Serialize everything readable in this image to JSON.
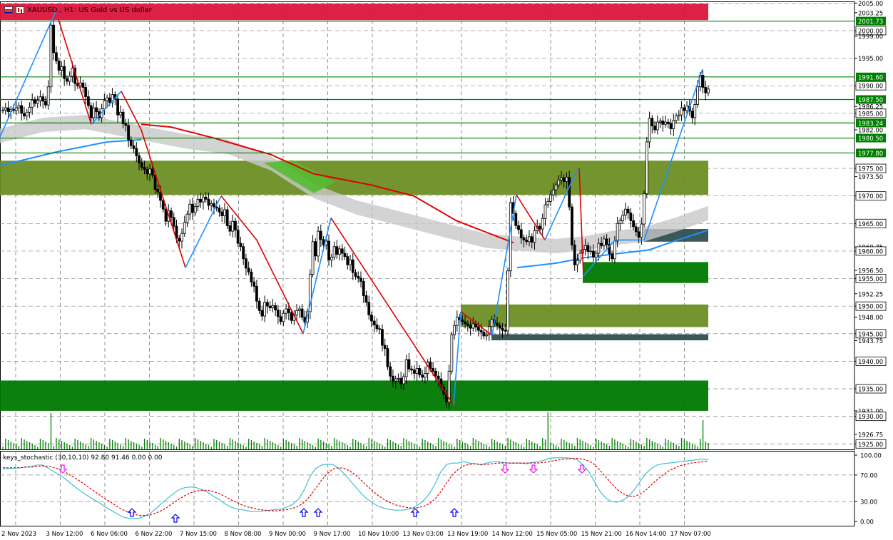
{
  "header": {
    "symbol_text": "XAUUSD., H1:  US Gold vs US dollar"
  },
  "stochastic": {
    "label": "keys_stochastic (30,10,10) 92.80 91.46 0.00 0.00"
  },
  "colors": {
    "bull": "#000000",
    "bear": "#000000",
    "red_zone": "#dc143c",
    "olive_zone": "#6b8e23",
    "green_zone": "#007800",
    "slate_zone": "#2f4f4f",
    "green_line": "#008000",
    "ma_red": "#e00000",
    "ma_blue": "#1e90ff",
    "cloud": "#c8c8c8",
    "zigzag_up": "#1e90ff",
    "zigzag_down": "#e00000",
    "stoch_main": "#40c0d0",
    "stoch_signal": "#e00000",
    "arrow_up": "#0000ff",
    "arrow_down": "#ff00ff"
  },
  "chart_data": [
    {
      "type": "candlestick",
      "title": "XAUUSD., H1:  US Gold vs US dollar",
      "ylim": [
        1924.0,
        2005.3
      ],
      "y_ticks": [
        "2005.00",
        "2003.25",
        "2000.00",
        "1999.00",
        "1995.00",
        "1990.00",
        "1986.25",
        "1985.00",
        "1982.00",
        "1975.00",
        "1973.50",
        "1970.00",
        "1965.00",
        "1960.75",
        "1960.00",
        "1956.50",
        "1955.00",
        "1952.25",
        "1950.00",
        "1948.00",
        "1945.00",
        "1943.75",
        "1940.00",
        "1935.00",
        "1931.00",
        "1930.00",
        "1926.75",
        "1925.00"
      ],
      "x_labels": [
        "2 Nov 2023",
        "3 Nov 12:00",
        "6 Nov 06:00",
        "6 Nov 22:00",
        "7 Nov 15:00",
        "8 Nov 08:00",
        "9 Nov 00:00",
        "9 Nov 17:00",
        "10 Nov 10:00",
        "13 Nov 03:00",
        "13 Nov 19:00",
        "14 Nov 12:00",
        "15 Nov 05:00",
        "15 Nov 21:00",
        "16 Nov 14:00",
        "17 Nov 07:00"
      ],
      "highlighted_levels": [
        {
          "label": "2001.73",
          "kind": "line"
        },
        {
          "label": "2000.00",
          "kind": "box"
        },
        {
          "label": "1991.60",
          "kind": "line"
        },
        {
          "label": "1990.00",
          "kind": "box"
        },
        {
          "label": "1987.50",
          "kind": "line"
        },
        {
          "label": "1985.00",
          "kind": "box"
        },
        {
          "label": "1983.24",
          "kind": "line"
        },
        {
          "label": "1980.50",
          "kind": "line"
        },
        {
          "label": "1977.80",
          "kind": "line"
        },
        {
          "label": "1975.00",
          "kind": "box"
        },
        {
          "label": "1970.00",
          "kind": "box"
        },
        {
          "label": "1965.00",
          "kind": "box"
        },
        {
          "label": "1960.00",
          "kind": "box"
        },
        {
          "label": "1955.00",
          "kind": "box"
        },
        {
          "label": "1950.00",
          "kind": "box"
        },
        {
          "label": "1945.00",
          "kind": "box"
        },
        {
          "label": "1940.00",
          "kind": "box"
        },
        {
          "label": "1935.00",
          "kind": "box"
        },
        {
          "label": "1930.00",
          "kind": "box"
        },
        {
          "label": "1925.00",
          "kind": "box"
        }
      ],
      "horizontal_lines": [
        2001.73,
        1991.6,
        1987.5,
        1983.24,
        1980.5,
        1977.8
      ],
      "zones": [
        {
          "top": 2004.9,
          "bottom": 2001.9,
          "color": "red_zone",
          "x_end": "15 Nov 21:00+"
        },
        {
          "top": 1976.4,
          "bottom": 1970.2,
          "color": "olive_zone",
          "x_end": "17 Nov 07:00-"
        },
        {
          "top": 1936.5,
          "bottom": 1931.0,
          "color": "green_zone",
          "x_end": "17 Nov 07:00-"
        },
        {
          "top": 1950.3,
          "bottom": 1946.2,
          "color": "olive_zone",
          "x_start": "13 Nov 03:00+"
        },
        {
          "top": 1944.9,
          "bottom": 1943.8,
          "color": "slate_zone",
          "x_start": "13 Nov 19:00-"
        },
        {
          "top": 1958.0,
          "bottom": 1954.2,
          "color": "green_zone",
          "x_start": "15 Nov 05:00"
        },
        {
          "top": 1964.0,
          "bottom": 1961.7,
          "color": "slate_zone",
          "x_start": "16 Nov 14:00-"
        }
      ],
      "candles_close": [
        1985.6,
        1986.0,
        1985.3,
        1985.7,
        1985.5,
        1986.0,
        1986.4,
        1985.0,
        1984.5,
        1985.2,
        1986.1,
        1987.4,
        1986.8,
        1987.3,
        1988.0,
        1987.2,
        1986.5,
        1989.8,
        2001.0,
        1996.0,
        1994.5,
        1992.8,
        1993.5,
        1991.3,
        1990.8,
        1991.7,
        1993.2,
        1990.4,
        1990.0,
        1990.5,
        1989.7,
        1988.0,
        1986.4,
        1984.2,
        1986.0,
        1985.3,
        1984.2,
        1985.8,
        1987.3,
        1987.8,
        1986.9,
        1988.4,
        1987.6,
        1984.7,
        1985.2,
        1983.1,
        1982.8,
        1980.2,
        1979.1,
        1978.6,
        1977.3,
        1976.0,
        1975.2,
        1974.8,
        1974.0,
        1974.9,
        1973.8,
        1971.2,
        1970.7,
        1969.2,
        1967.6,
        1965.4,
        1967.3,
        1966.1,
        1964.5,
        1962.3,
        1961.8,
        1963.2,
        1965.2,
        1966.7,
        1968.5,
        1967.0,
        1968.1,
        1969.4,
        1968.9,
        1969.8,
        1969.4,
        1968.3,
        1968.6,
        1968.0,
        1967.8,
        1967.1,
        1966.4,
        1967.5,
        1964.6,
        1963.6,
        1965.4,
        1963.8,
        1961.4,
        1960.8,
        1958.6,
        1956.9,
        1956.2,
        1954.4,
        1953.6,
        1950.9,
        1949.2,
        1948.2,
        1950.7,
        1950.0,
        1949.7,
        1950.1,
        1949.3,
        1948.1,
        1947.2,
        1948.7,
        1949.5,
        1948.8,
        1947.4,
        1948.4,
        1949.2,
        1949.5,
        1948.0,
        1947.1,
        1949.0,
        1955.8,
        1961.7,
        1959.1,
        1963.6,
        1962.1,
        1961.1,
        1961.8,
        1958.4,
        1958.9,
        1960.8,
        1959.4,
        1960.4,
        1959.6,
        1959.0,
        1957.5,
        1958.4,
        1956.1,
        1955.4,
        1955.1,
        1954.5,
        1951.9,
        1950.7,
        1948.4,
        1947.3,
        1946.6,
        1945.9,
        1945.8,
        1942.9,
        1942.3,
        1939.0,
        1937.3,
        1936.4,
        1936.8,
        1936.9,
        1935.9,
        1937.2,
        1940.3,
        1938.6,
        1938.4,
        1937.8,
        1938.7,
        1937.5,
        1937.1,
        1937.8,
        1939.8,
        1938.7,
        1938.2,
        1937.3,
        1936.8,
        1935.3,
        1934.0,
        1932.6,
        1938.2,
        1944.8,
        1946.5,
        1948.0,
        1947.5,
        1947.2,
        1946.8,
        1946.5,
        1946.0,
        1946.8,
        1946.2,
        1945.6,
        1945.3,
        1944.6,
        1944.8,
        1946.3,
        1947.6,
        1946.9,
        1946.5,
        1946.0,
        1945.6,
        1945.5,
        1956.4,
        1968.8,
        1966.8,
        1964.6,
        1963.9,
        1962.4,
        1962.0,
        1961.7,
        1962.6,
        1961.6,
        1963.7,
        1964.5,
        1964.0,
        1965.9,
        1968.4,
        1969.0,
        1970.2,
        1971.1,
        1972.0,
        1972.9,
        1973.3,
        1972.6,
        1973.4,
        1968.0,
        1961.1,
        1957.5,
        1958.3,
        1959.6,
        1960.3,
        1961.0,
        1959.9,
        1960.0,
        1958.9,
        1959.6,
        1961.4,
        1961.0,
        1962.2,
        1961.2,
        1959.5,
        1958.6,
        1961.8,
        1965.0,
        1965.5,
        1966.5,
        1967.6,
        1966.9,
        1965.5,
        1964.4,
        1963.5,
        1962.5,
        1964.9,
        1970.4,
        1979.8,
        1984.1,
        1982.7,
        1982.0,
        1983.4,
        1983.6,
        1983.0,
        1983.4,
        1983.1,
        1982.2,
        1983.7,
        1984.5,
        1984.7,
        1986.0,
        1985.5,
        1986.3,
        1985.4,
        1984.2,
        1986.6,
        1989.8,
        1991.9,
        1989.7,
        1988.7,
        1989.4
      ]
    },
    {
      "type": "line",
      "title": "keys_stochastic (30,10,10) 92.80 91.46 0.00 0.00",
      "ylim": [
        0,
        100
      ],
      "y_ticks": [
        "100.00",
        "70.00",
        "30.00",
        "0.00"
      ],
      "series": [
        {
          "role": "main",
          "values": [
            79,
            80,
            80,
            81,
            82,
            83,
            85,
            85,
            80,
            75,
            70,
            64,
            57,
            50,
            44,
            38,
            33,
            28,
            22,
            17,
            12,
            7,
            5,
            4,
            5,
            8,
            13,
            20,
            28,
            35,
            42,
            48,
            51,
            52,
            51,
            48,
            44,
            38,
            33,
            27,
            22,
            19,
            18,
            16,
            15,
            15,
            16,
            17,
            18,
            19,
            22,
            26,
            34,
            48,
            68,
            80,
            85,
            86,
            86,
            80,
            72,
            62,
            52,
            42,
            34,
            28,
            23,
            20,
            18,
            17,
            17,
            18,
            20,
            25,
            32,
            42,
            57,
            75,
            86,
            88,
            88,
            90,
            88,
            87,
            85,
            88,
            90,
            90,
            89,
            88,
            88,
            88,
            87,
            89,
            90,
            92,
            95,
            96,
            96,
            96,
            95,
            93,
            85,
            75,
            60,
            45,
            35,
            30,
            29,
            32,
            38,
            48,
            60,
            72,
            80,
            85,
            87,
            88,
            89,
            90,
            91,
            92,
            93,
            94,
            93
          ]
        },
        {
          "role": "signal",
          "values": [
            81,
            81,
            81,
            81,
            82,
            82,
            83,
            84,
            83,
            81,
            78,
            74,
            69,
            64,
            58,
            52,
            46,
            40,
            34,
            29,
            23,
            18,
            14,
            11,
            9,
            9,
            10,
            13,
            17,
            22,
            28,
            34,
            39,
            43,
            46,
            47,
            47,
            45,
            42,
            38,
            33,
            29,
            25,
            22,
            20,
            18,
            17,
            16,
            16,
            17,
            18,
            20,
            23,
            29,
            38,
            50,
            62,
            72,
            79,
            81,
            80,
            76,
            70,
            62,
            54,
            46,
            39,
            33,
            29,
            25,
            23,
            21,
            20,
            21,
            23,
            27,
            34,
            45,
            58,
            70,
            78,
            84,
            86,
            87,
            86,
            86,
            87,
            88,
            88,
            88,
            88,
            88,
            88,
            88,
            88,
            89,
            90,
            92,
            93,
            94,
            95,
            95,
            94,
            91,
            86,
            77,
            67,
            57,
            48,
            42,
            38,
            38,
            41,
            47,
            55,
            63,
            70,
            76,
            80,
            84,
            86,
            88,
            89,
            90,
            91
          ]
        }
      ],
      "arrows": [
        {
          "dir": "down",
          "at": "3 Nov 12:00"
        },
        {
          "dir": "up",
          "at": "6 Nov 22:00-"
        },
        {
          "dir": "up",
          "at": "6 Nov 22:00+"
        },
        {
          "dir": "up",
          "at": "9 Nov 00:00"
        },
        {
          "dir": "up",
          "at": "9 Nov 00:00+"
        },
        {
          "dir": "up",
          "at": "13 Nov 03:00"
        },
        {
          "dir": "up",
          "at": "13 Nov 03:00+"
        },
        {
          "dir": "down",
          "at": "14 Nov 12:00-"
        },
        {
          "dir": "down",
          "at": "14 Nov 12:00+"
        },
        {
          "dir": "down",
          "at": "15 Nov 05:00+"
        }
      ]
    }
  ]
}
